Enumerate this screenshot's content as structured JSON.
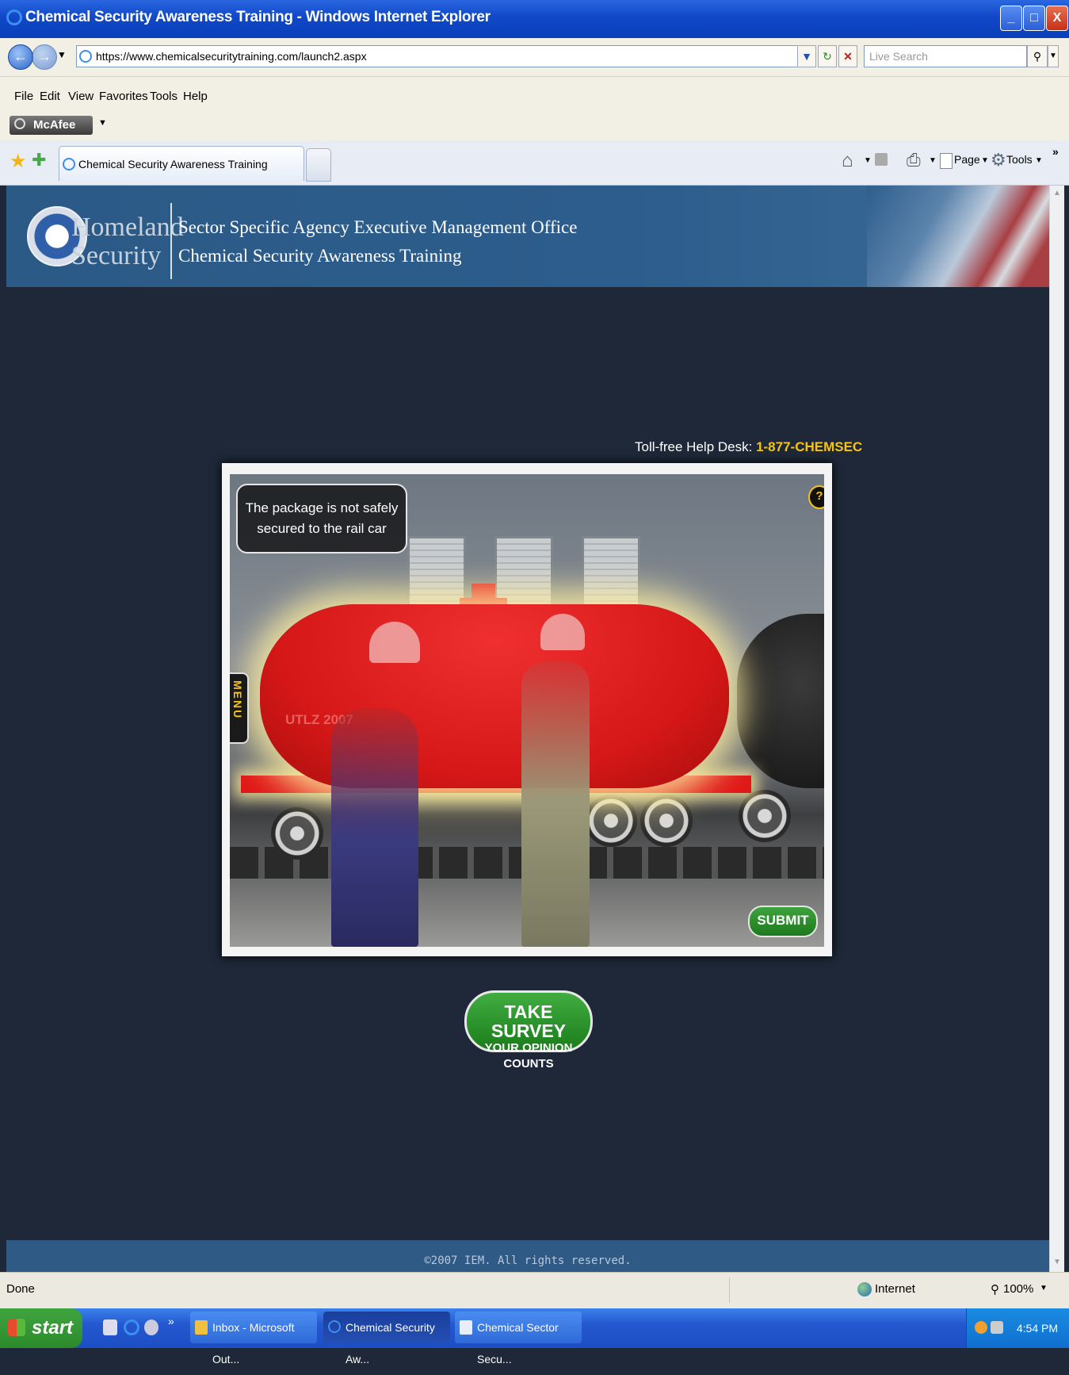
{
  "window": {
    "title": "Chemical Security Awareness Training - Windows Internet Explorer",
    "min": "_",
    "max": "□",
    "close": "X"
  },
  "address": {
    "url": "https://www.chemicalsecuritytraining.com/launch2.aspx",
    "search_placeholder": "Live Search"
  },
  "menu": [
    "File",
    "Edit",
    "View",
    "Favorites",
    "Tools",
    "Help"
  ],
  "mcafee": "McAfee",
  "tab": {
    "label": "Chemical Security Awareness Training"
  },
  "commands": {
    "page": "Page",
    "tools": "Tools"
  },
  "banner": {
    "logo_line1": "Homeland",
    "logo_line2": "Security",
    "line1": "Sector Specific Agency Executive Management Office",
    "line2": "Chemical Security Awareness Training"
  },
  "help": {
    "label": "Toll-free Help Desk:",
    "number": "1-877-CHEMSEC"
  },
  "training": {
    "callout": "The package is not safely secured to the rail car",
    "help_icon": "?",
    "menu_label": "MENU",
    "tank_text": "UTLZ 2007",
    "submit_label": "SUBMIT"
  },
  "survey": {
    "title": "TAKE SURVEY",
    "subtitle": "YOUR OPINION COUNTS"
  },
  "footer": {
    "copyright": "©2007 IEM. All rights reserved."
  },
  "statusbar": {
    "status": "Done",
    "zone": "Internet",
    "zoom": "100%"
  },
  "taskbar": {
    "start": "start",
    "tasks": [
      "Inbox - Microsoft Out...",
      "Chemical Security Aw...",
      "Chemical Sector Secu..."
    ],
    "clock": "4:54 PM"
  }
}
